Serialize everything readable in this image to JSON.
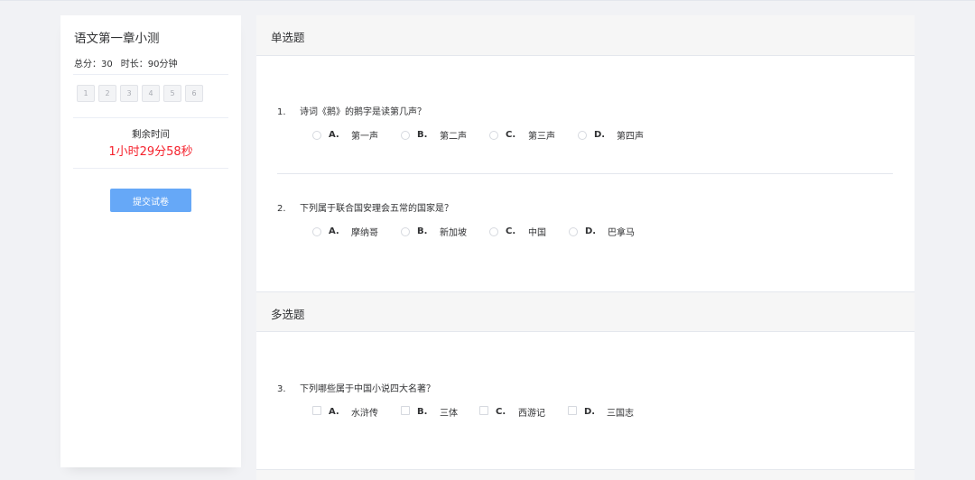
{
  "exam": {
    "title": "语文第一章小测",
    "total_score": "总分：30",
    "duration": "时长：90分钟"
  },
  "question_nav": [
    "1",
    "2",
    "3",
    "4",
    "5",
    "6"
  ],
  "timer": {
    "label": "剩余时间",
    "value": "1小时29分58秒"
  },
  "submit_label": "提交试卷",
  "sections": {
    "single": {
      "title": "单选题",
      "questions": [
        {
          "number": "1.",
          "text": "诗词《鹅》的鹅字是读第几声？",
          "options": [
            {
              "letter": "A.",
              "text": "第一声"
            },
            {
              "letter": "B.",
              "text": "第二声"
            },
            {
              "letter": "C.",
              "text": "第三声"
            },
            {
              "letter": "D.",
              "text": "第四声"
            }
          ]
        },
        {
          "number": "2.",
          "text": "下列属于联合国安理会五常的国家是？",
          "options": [
            {
              "letter": "A.",
              "text": "摩纳哥"
            },
            {
              "letter": "B.",
              "text": "新加坡"
            },
            {
              "letter": "C.",
              "text": "中国"
            },
            {
              "letter": "D.",
              "text": "巴拿马"
            }
          ]
        }
      ]
    },
    "multi": {
      "title": "多选题",
      "questions": [
        {
          "number": "3.",
          "text": "下列哪些属于中国小说四大名著？",
          "options": [
            {
              "letter": "A.",
              "text": "水浒传"
            },
            {
              "letter": "B.",
              "text": "三体"
            },
            {
              "letter": "C.",
              "text": "西游记"
            },
            {
              "letter": "D.",
              "text": "三国志"
            }
          ]
        }
      ]
    }
  },
  "colors": {
    "timer": "#f5222d",
    "submit_button": "#66a8f7",
    "page_background": "#f1f2f5"
  }
}
